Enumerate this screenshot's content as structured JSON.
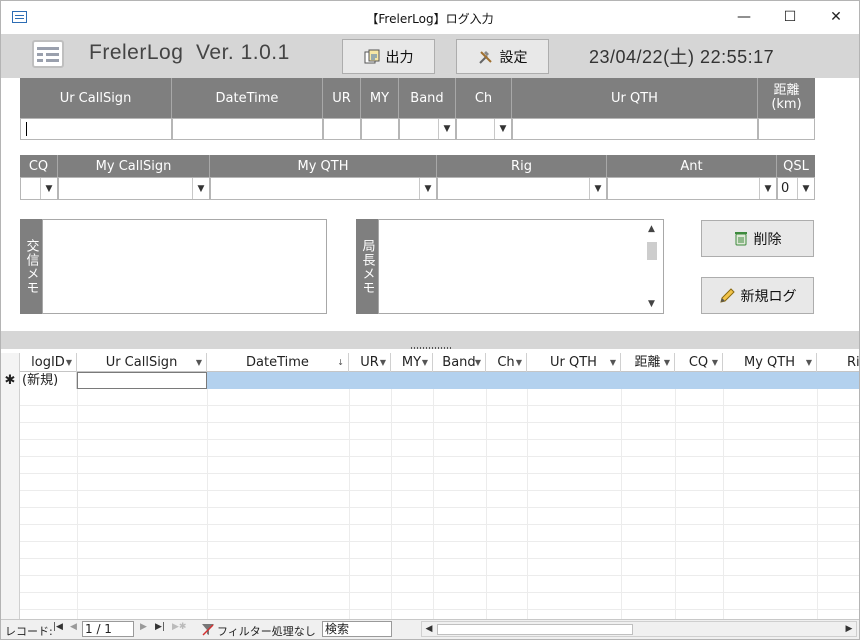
{
  "window": {
    "title": "【FrelerLog】ログ入力",
    "minimize": "—",
    "maximize": "☐",
    "close": "✕"
  },
  "header": {
    "app_name": "FrelerLog  Ver. 1.0.1",
    "output_button": "出力",
    "settings_button": "設定",
    "datetime": "23/04/22(土) 22:55:17"
  },
  "qso_fields": {
    "headers": [
      "Ur CallSign",
      "DateTime",
      "UR",
      "MY",
      "Band",
      "Ch",
      "Ur QTH",
      "距離\n(km)"
    ]
  },
  "station_fields": {
    "headers": [
      "CQ",
      "My CallSign",
      "My QTH",
      "Rig",
      "Ant",
      "QSL"
    ],
    "qsl_value": "0"
  },
  "memo": {
    "qso_memo_label": "交信メモ",
    "station_memo_label": "局長メモ"
  },
  "actions": {
    "delete_button": "削除",
    "new_log_button": "新規ログ"
  },
  "datasheet": {
    "columns": [
      "logID",
      "Ur CallSign",
      "DateTime",
      "UR",
      "MY",
      "Band",
      "Ch",
      "Ur QTH",
      "距離",
      "CQ",
      "My QTH",
      "Ri"
    ],
    "new_row_marker": "✱",
    "new_row_label": "(新規)"
  },
  "status_bar": {
    "record_label": "レコード:",
    "record_value": "1 / 1",
    "filter_label": "フィルター処理なし",
    "search_label": "検索"
  },
  "colors": {
    "header_band": "#d6d6d6",
    "field_header": "#7f7f7f",
    "selected_row": "#b3d1ee"
  }
}
